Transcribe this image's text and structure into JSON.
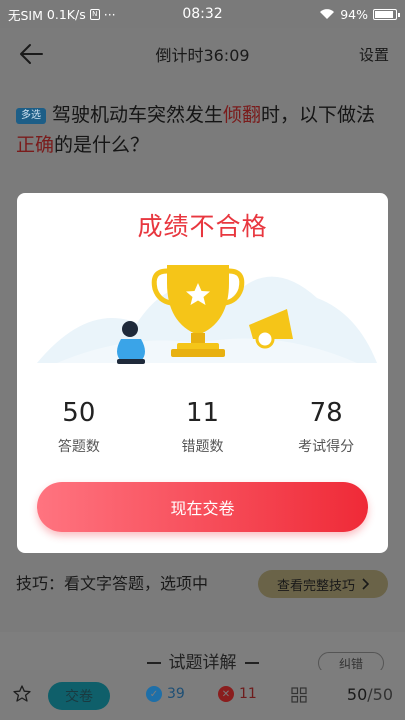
{
  "status_bar": {
    "carrier": "无SIM",
    "speed": "0.1K/s",
    "sim_glyph": "N",
    "dots": "···",
    "time": "08:32",
    "battery": "94%"
  },
  "header": {
    "title": "倒计时36:09",
    "settings": "设置"
  },
  "question": {
    "tag": "多选",
    "text_part1": "驾驶机动车突然发生",
    "highlight1": "倾翻",
    "text_part2": "时，以下做法",
    "highlight2": "正确",
    "text_part3": "的是什么？"
  },
  "tip": {
    "text": "技巧：看文字答题，选项中",
    "button": "查看完整技巧"
  },
  "detail": {
    "title": "试题详解",
    "correct_button": "纠错"
  },
  "modal": {
    "title": "成绩不合格",
    "stats": [
      {
        "value": "50",
        "label": "答题数"
      },
      {
        "value": "11",
        "label": "错题数"
      },
      {
        "value": "78",
        "label": "考试得分"
      }
    ],
    "button": "现在交卷"
  },
  "bottom_bar": {
    "submit": "交卷",
    "correct_count": "39",
    "wrong_count": "11",
    "current": "50",
    "total": "/50"
  },
  "colors": {
    "accent_red": "#e8373f",
    "correct_blue": "#1e6fa8",
    "wrong_red": "#8a1d1d"
  }
}
